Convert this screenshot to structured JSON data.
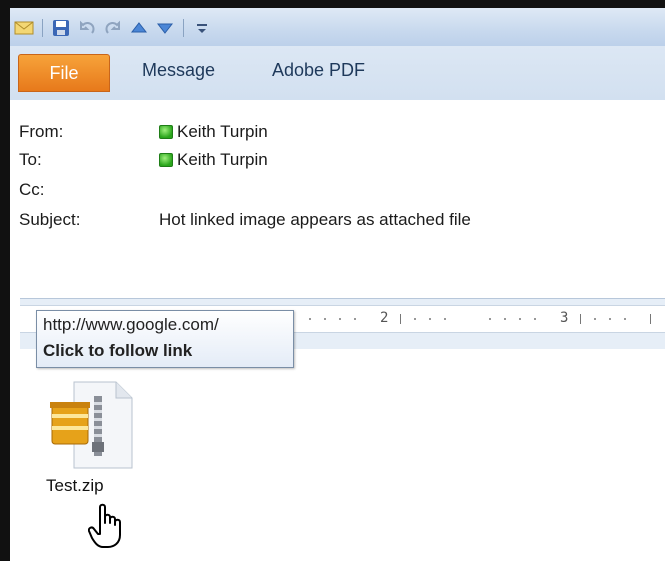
{
  "ribbon": {
    "tabs": [
      "File",
      "Message",
      "Adobe PDF"
    ]
  },
  "message": {
    "from_label": "From:",
    "from_value": "Keith Turpin",
    "to_label": "To:",
    "to_value": "Keith Turpin",
    "cc_label": "Cc:",
    "cc_value": "",
    "subject_label": "Subject:",
    "subject_value": "Hot linked image appears as attached file"
  },
  "ruler": {
    "marks": [
      "2",
      "3"
    ]
  },
  "tooltip": {
    "url": "http://www.google.com/",
    "action": "Click to follow link"
  },
  "attachment": {
    "filename": "Test.zip"
  },
  "colors": {
    "file_tab": "#e7791b",
    "presence": "#2aa51c",
    "ribbon": "#d2e0f0"
  }
}
